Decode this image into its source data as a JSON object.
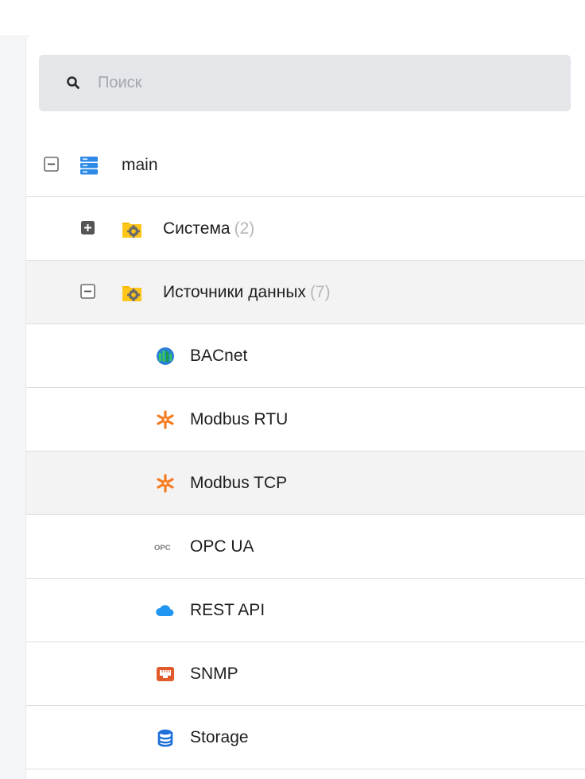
{
  "search": {
    "placeholder": "Поиск",
    "value": ""
  },
  "tree": {
    "root": {
      "label": "main",
      "icon": "server-icon",
      "expanded": true
    },
    "folders": [
      {
        "label": "Система",
        "count": "(2)",
        "icon": "gear-folder-icon",
        "expanded": false
      },
      {
        "label": "Источники данных",
        "count": "(7)",
        "icon": "gear-folder-icon",
        "expanded": true
      }
    ],
    "items": [
      {
        "label": "BACnet",
        "icon": "bacnet-icon"
      },
      {
        "label": "Modbus RTU",
        "icon": "modbus-icon"
      },
      {
        "label": "Modbus TCP",
        "icon": "modbus-icon"
      },
      {
        "label": "OPC UA",
        "icon": "opc-icon"
      },
      {
        "label": "REST API",
        "icon": "cloud-icon"
      },
      {
        "label": "SNMP",
        "icon": "snmp-icon"
      },
      {
        "label": "Storage",
        "icon": "database-icon"
      }
    ]
  },
  "colors": {
    "folder": "#f5b800",
    "server": "#2e8ae6",
    "modbus": "#f47b20",
    "cloud": "#2196f3",
    "snmp": "#e05a2b",
    "database": "#1e6fd9",
    "count": "#b5b7bb"
  }
}
